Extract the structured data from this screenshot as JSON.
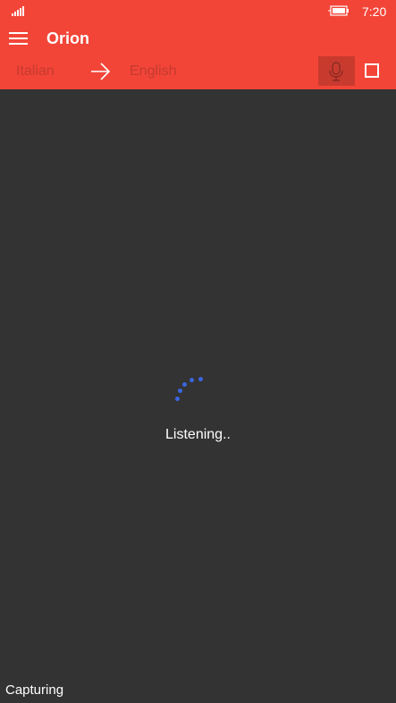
{
  "status_bar": {
    "time": "7:20",
    "icons": [
      "signal-icon",
      "battery-charging-icon"
    ]
  },
  "app_bar": {
    "title": "Orion",
    "source_language": "Italian",
    "target_language": "English",
    "icons": [
      "hamburger-menu-icon",
      "arrow-right-icon",
      "microphone-icon",
      "stop-icon"
    ]
  },
  "main": {
    "status_text": "Listening..",
    "spinner_icon": "progress-dots-icon"
  },
  "footer": {
    "state_text": "Capturing"
  },
  "colors": {
    "accent": "#f24538",
    "mic_active": "#c93a2e",
    "language_text": "#c43a2f",
    "background": "#333333",
    "spinner": "#3a66e0"
  }
}
